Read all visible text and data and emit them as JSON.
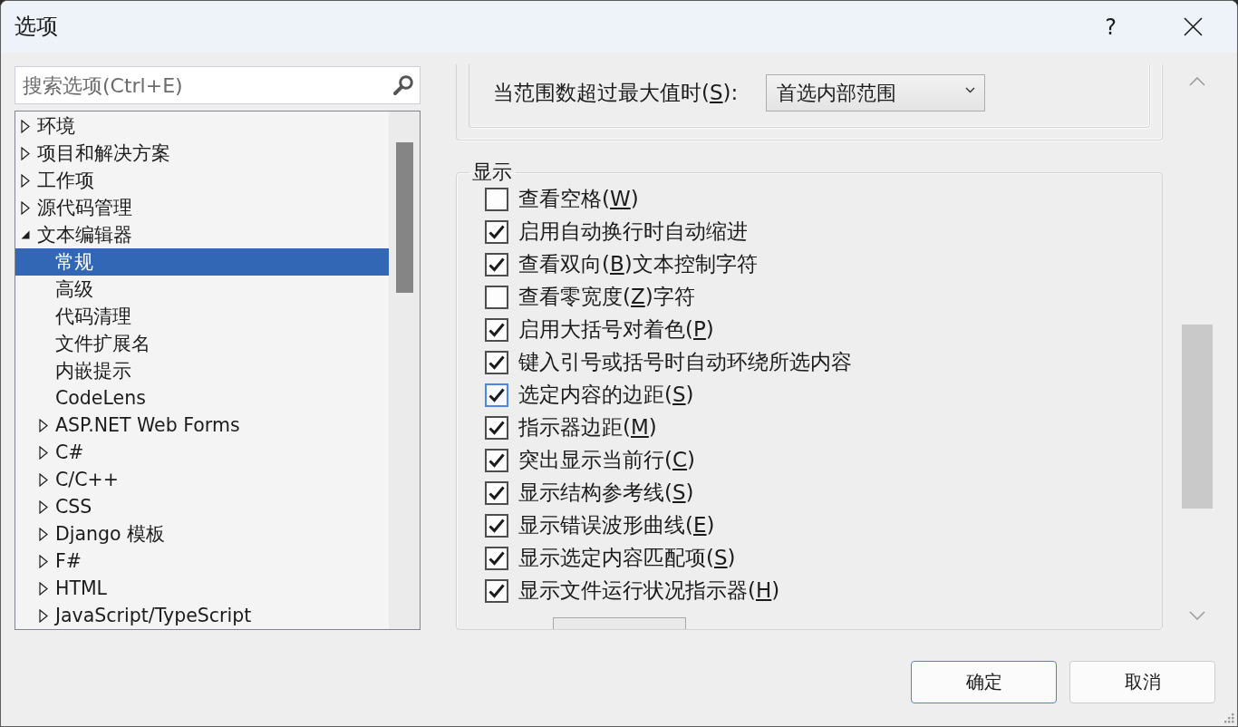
{
  "window": {
    "title": "选项",
    "help_label": "?"
  },
  "search": {
    "placeholder": "搜索选项(Ctrl+E)"
  },
  "tree": [
    {
      "label": "环境",
      "kind": "group",
      "expanded": false,
      "selected": false
    },
    {
      "label": "项目和解决方案",
      "kind": "group",
      "expanded": false,
      "selected": false
    },
    {
      "label": "工作项",
      "kind": "group",
      "expanded": false,
      "selected": false
    },
    {
      "label": "源代码管理",
      "kind": "group",
      "expanded": false,
      "selected": false
    },
    {
      "label": "文本编辑器",
      "kind": "group",
      "expanded": true,
      "selected": false,
      "children": [
        {
          "label": "常规",
          "kind": "page",
          "selected": true
        },
        {
          "label": "高级",
          "kind": "page",
          "selected": false
        },
        {
          "label": "代码清理",
          "kind": "page",
          "selected": false
        },
        {
          "label": "文件扩展名",
          "kind": "page",
          "selected": false
        },
        {
          "label": "内嵌提示",
          "kind": "page",
          "selected": false
        },
        {
          "label": "CodeLens",
          "kind": "page",
          "selected": false
        },
        {
          "label": "ASP.NET Web Forms",
          "kind": "group",
          "expanded": false,
          "selected": false
        },
        {
          "label": "C#",
          "kind": "group",
          "expanded": false,
          "selected": false
        },
        {
          "label": "C/C++",
          "kind": "group",
          "expanded": false,
          "selected": false
        },
        {
          "label": "CSS",
          "kind": "group",
          "expanded": false,
          "selected": false
        },
        {
          "label": "Django 模板",
          "kind": "group",
          "expanded": false,
          "selected": false
        },
        {
          "label": "F#",
          "kind": "group",
          "expanded": false,
          "selected": false
        },
        {
          "label": "HTML",
          "kind": "group",
          "expanded": false,
          "selected": false
        },
        {
          "label": "JavaScript/TypeScript",
          "kind": "group",
          "expanded": false,
          "selected": false
        }
      ]
    }
  ],
  "range_setting": {
    "label": "当范围数超过最大值时(",
    "access_key": "S",
    "label_end": "):",
    "value": "首选内部范围"
  },
  "display_group": {
    "title": "显示",
    "options": [
      {
        "label": "查看空格(",
        "access_key": "W",
        "label_end": ")",
        "checked": false,
        "focused": false
      },
      {
        "label": "启用自动换行时自动缩进",
        "checked": true,
        "focused": false
      },
      {
        "label": "查看双向(",
        "access_key": "B",
        "label_end": ")文本控制字符",
        "checked": true,
        "focused": false
      },
      {
        "label": "查看零宽度(",
        "access_key": "Z",
        "label_end": ")字符",
        "checked": false,
        "focused": false
      },
      {
        "label": "启用大括号对着色(",
        "access_key": "P",
        "label_end": ")",
        "checked": true,
        "focused": false
      },
      {
        "label": "键入引号或括号时自动环绕所选内容",
        "checked": true,
        "focused": false
      },
      {
        "label": "选定内容的边距(",
        "access_key": "S",
        "label_end": ")",
        "checked": true,
        "focused": true
      },
      {
        "label": "指示器边距(",
        "access_key": "M",
        "label_end": ")",
        "checked": true,
        "focused": false
      },
      {
        "label": "突出显示当前行(",
        "access_key": "C",
        "label_end": ")",
        "checked": true,
        "focused": false
      },
      {
        "label": "显示结构参考线(",
        "access_key": "S",
        "label_end": ")",
        "checked": true,
        "focused": false
      },
      {
        "label": "显示错误波形曲线(",
        "access_key": "E",
        "label_end": ")",
        "checked": true,
        "focused": false
      },
      {
        "label": "显示选定内容匹配项(",
        "access_key": "S",
        "label_end": ")",
        "checked": true,
        "focused": false
      },
      {
        "label": "显示文件运行状况指示器(",
        "access_key": "H",
        "label_end": ")",
        "checked": true,
        "focused": false
      }
    ]
  },
  "buttons": [
    {
      "label": "确定",
      "default": true
    },
    {
      "label": "取消",
      "default": false
    }
  ]
}
